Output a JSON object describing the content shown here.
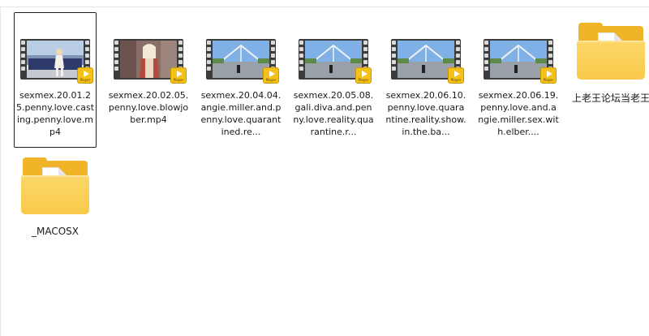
{
  "items": [
    {
      "name": "sexmex.20.01.25.penny.love.casting.penny.love.mp4",
      "label": "sexmex.20.01.25.penny.love.casting.penny.love.mp4",
      "type": "video",
      "selected": true,
      "icon": "video-thumbnail-icon",
      "badge": "Player"
    },
    {
      "name": "sexmex.20.02.05.penny.love.blowjober.mp4",
      "label": "sexmex.20.02.05.penny.love.blowjober.mp4",
      "type": "video",
      "selected": false,
      "icon": "video-thumbnail-icon",
      "badge": "Player"
    },
    {
      "name": "sexmex.20.04.04.angie.miller.and.penny.love.quarantined.re...",
      "label": "sexmex.20.04.04.angie.miller.and.penny.love.quarantined.re...",
      "type": "video",
      "selected": false,
      "icon": "video-thumbnail-icon",
      "badge": "Player"
    },
    {
      "name": "sexmex.20.05.08.gali.diva.and.penny.love.reality.quarantine.r...",
      "label": "sexmex.20.05.08.gali.diva.and.penny.love.reality.quarantine.r...",
      "type": "video",
      "selected": false,
      "icon": "video-thumbnail-icon",
      "badge": "Player"
    },
    {
      "name": "sexmex.20.06.10.penny.love.quarantine.reality.show.in.the.ba...",
      "label": "sexmex.20.06.10.penny.love.quarantine.reality.show.in.the.ba...",
      "type": "video",
      "selected": false,
      "icon": "video-thumbnail-icon",
      "badge": "Player"
    },
    {
      "name": "sexmex.20.06.19.penny.love.and.angie.miller.sex.with.elber....",
      "label": "sexmex.20.06.19.penny.love.and.angie.miller.sex.with.elber....",
      "type": "video",
      "selected": false,
      "icon": "video-thumbnail-icon",
      "badge": "Player"
    },
    {
      "name": "上老王论坛当老王",
      "label": "上老王论坛当老王",
      "type": "folder",
      "selected": false,
      "icon": "folder-icon"
    },
    {
      "name": "_MACOSX",
      "label": "_MACOSX",
      "type": "folder",
      "selected": false,
      "icon": "folder-with-document-icon"
    }
  ],
  "colors": {
    "folder": "#f8c94a",
    "badge": "#f3c118",
    "selection_border": "#1f1f1f"
  }
}
